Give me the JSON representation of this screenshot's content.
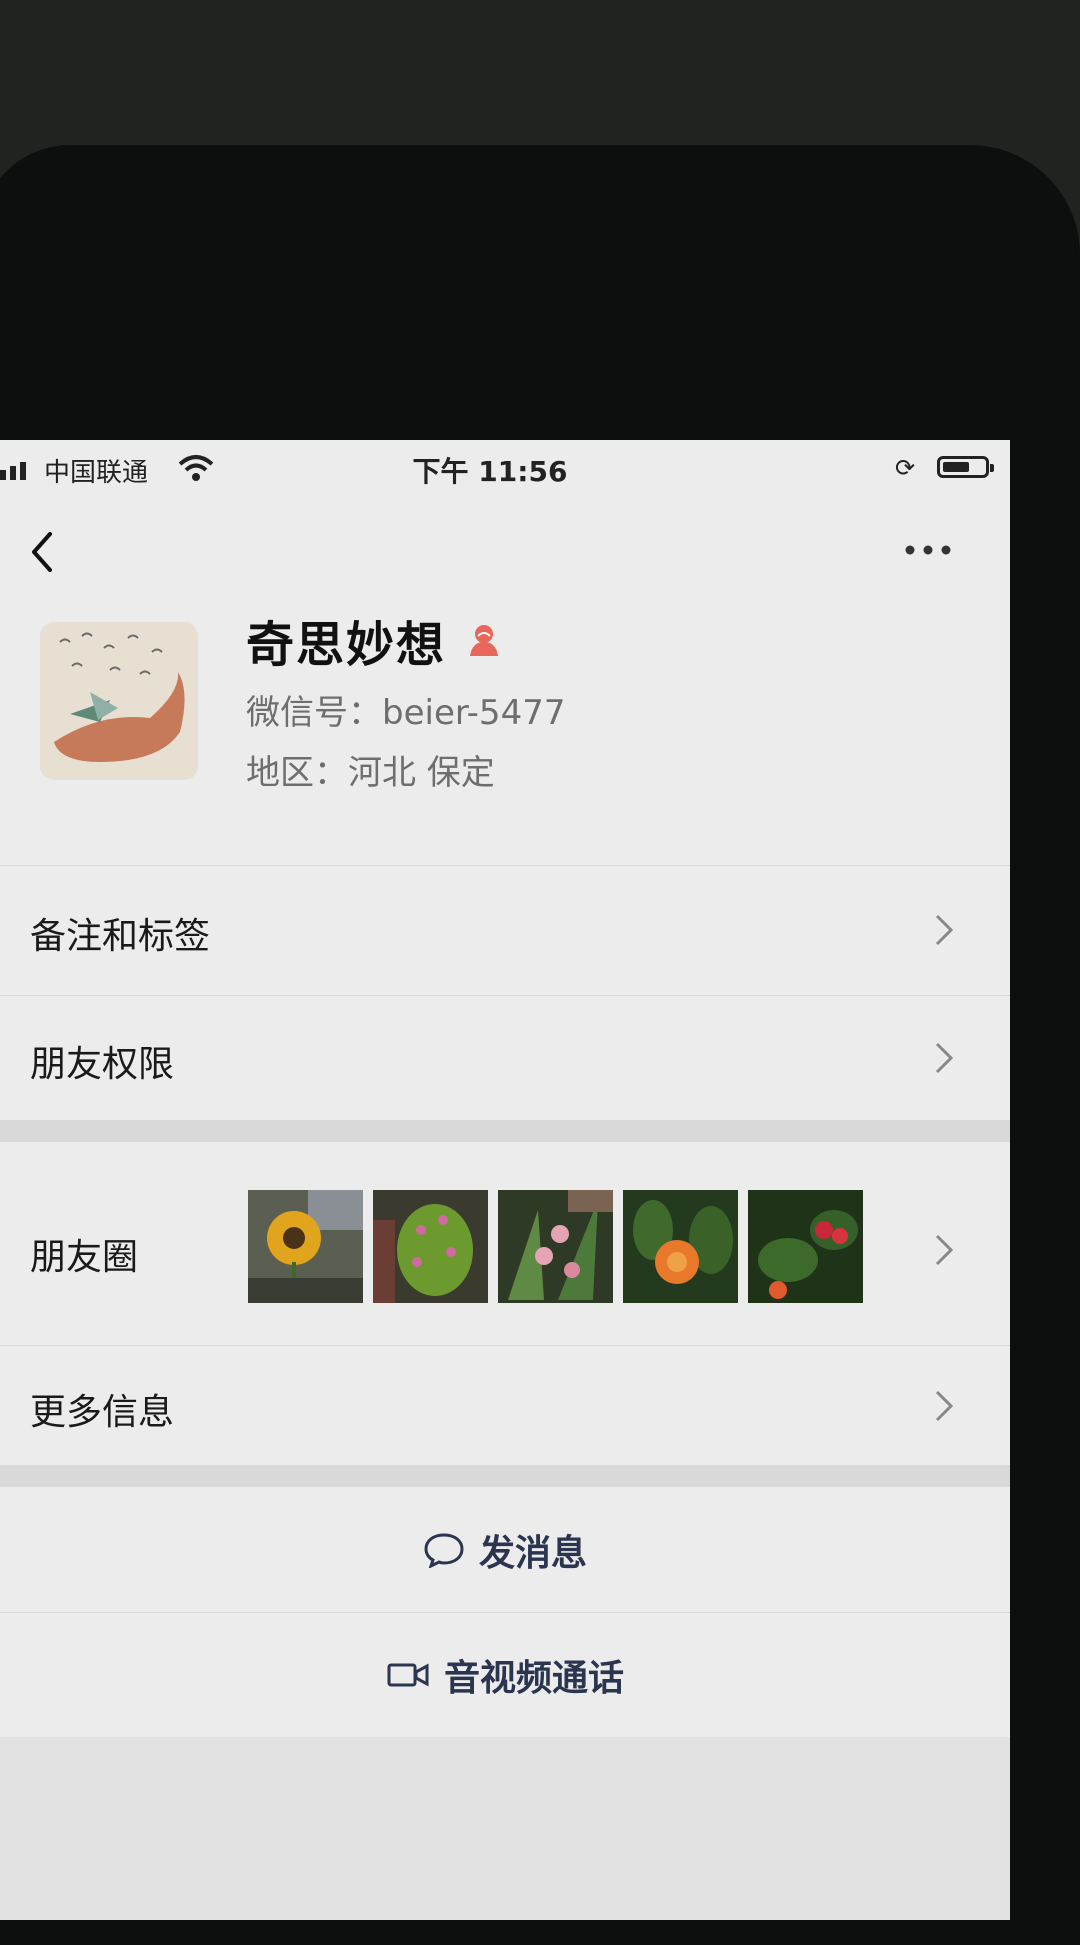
{
  "status_bar": {
    "carrier": "中国联通",
    "time": "下午 11:56"
  },
  "profile": {
    "name": "奇思妙想",
    "wechat_id": "微信号：beier-5477",
    "region": "地区：河北 保定"
  },
  "menu": {
    "remarks_tags": "备注和标签",
    "friend_permissions": "朋友权限",
    "moments": "朋友圈",
    "more_info": "更多信息"
  },
  "actions": {
    "send_message": "发消息",
    "video_call": "音视频通话"
  },
  "icons": {
    "back": "chevron-left-icon",
    "more": "ellipsis-icon",
    "gender": "female-icon",
    "chat": "chat-bubble-icon",
    "video": "video-camera-icon",
    "chevron": "chevron-right-icon"
  },
  "colors": {
    "gender_icon": "#e8665a",
    "action_text": "#2b3550"
  }
}
